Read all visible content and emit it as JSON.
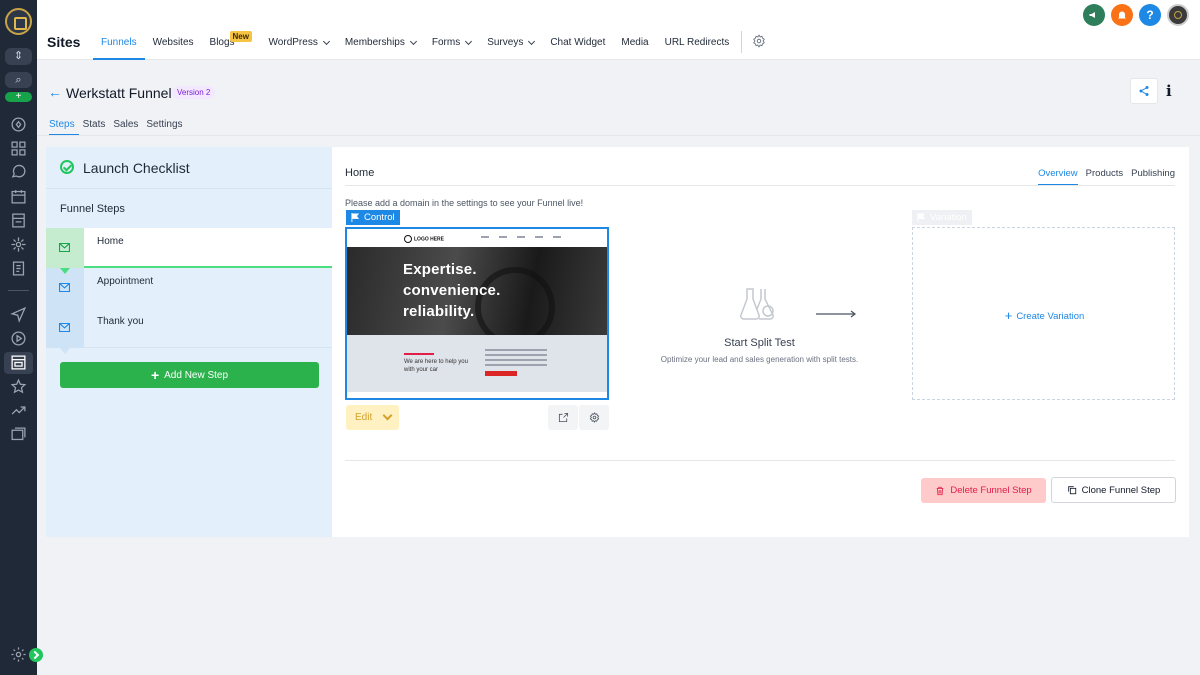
{
  "app": {
    "title": "Sites"
  },
  "nav": {
    "items": [
      {
        "label": "Funnels",
        "active": true
      },
      {
        "label": "Websites"
      },
      {
        "label": "Blogs",
        "badge": "New"
      },
      {
        "label": "WordPress",
        "dropdown": true
      },
      {
        "label": "Memberships",
        "dropdown": true
      },
      {
        "label": "Forms",
        "dropdown": true
      },
      {
        "label": "Surveys",
        "dropdown": true
      },
      {
        "label": "Chat Widget"
      },
      {
        "label": "Media"
      },
      {
        "label": "URL Redirects"
      }
    ],
    "help_label": "?"
  },
  "funnel": {
    "title": "Werkstatt Funnel",
    "version": "Version 2",
    "info_label": "i",
    "tabs": [
      "Steps",
      "Stats",
      "Sales",
      "Settings"
    ]
  },
  "left": {
    "checklist_title": "Launch Checklist",
    "steps_label": "Funnel Steps",
    "steps": [
      "Home",
      "Appointment",
      "Thank you"
    ],
    "add_step_label": "Add New Step",
    "add_step_plus": "+"
  },
  "right": {
    "title": "Home",
    "tabs": [
      "Overview",
      "Products",
      "Publishing"
    ],
    "notice": "Please add a domain in the settings to see your Funnel live!",
    "control_label": "Control",
    "variation_label": "Variation",
    "edit_label": "Edit",
    "split_title": "Start Split Test",
    "split_desc": "Optimize your lead and sales generation with split tests.",
    "create_variation_label": "Create Variation",
    "create_variation_plus": "+",
    "delete_label": "Delete Funnel Step",
    "clone_label": "Clone Funnel Step"
  },
  "thumbnail": {
    "logo": "LOGO HERE",
    "headline": [
      "Expertise.",
      "convenience.",
      "reliability."
    ],
    "subline": [
      "We are here to help you",
      "with your car"
    ]
  },
  "colors": {
    "accent": "#1e88e5",
    "success": "#2bb24c",
    "danger": "#e11d48",
    "rail": "#1f2937"
  }
}
